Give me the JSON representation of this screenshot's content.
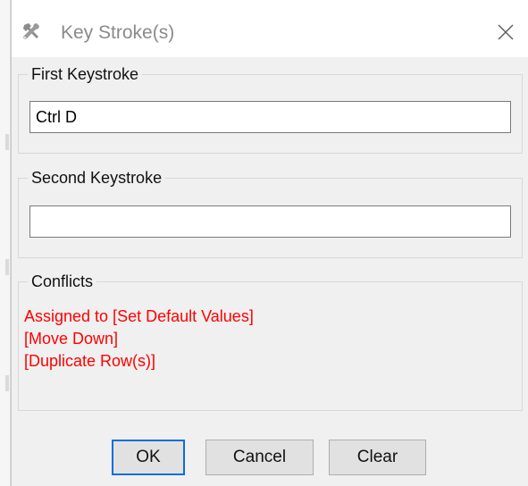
{
  "dialog": {
    "title": "Key Stroke(s)",
    "title_icon": "tools-icon",
    "close_icon": "close-icon"
  },
  "first_keystroke": {
    "label": "First Keystroke",
    "value": "Ctrl D"
  },
  "second_keystroke": {
    "label": "Second Keystroke",
    "value": ""
  },
  "conflicts": {
    "label": "Conflicts",
    "lines": [
      "Assigned to [Set Default Values]",
      "[Move Down]",
      "[Duplicate Row(s)]"
    ],
    "color": "#ff0000"
  },
  "buttons": {
    "ok": "OK",
    "cancel": "Cancel",
    "clear": "Clear"
  },
  "colors": {
    "dialog_background": "#f0f0f0",
    "default_button_border": "#0a6fd6"
  }
}
